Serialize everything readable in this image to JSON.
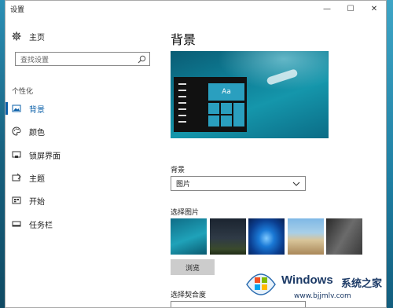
{
  "window": {
    "title": "设置",
    "controls": [
      "—",
      "☐",
      "✕"
    ]
  },
  "nav": {
    "home_label": "主页",
    "search_placeholder": "查找设置",
    "section_title": "个性化",
    "items": [
      {
        "label": "背景",
        "icon": "picture-icon",
        "active": true
      },
      {
        "label": "颜色",
        "icon": "palette-icon",
        "active": false
      },
      {
        "label": "锁屏界面",
        "icon": "lock-screen-icon",
        "active": false
      },
      {
        "label": "主题",
        "icon": "theme-icon",
        "active": false
      },
      {
        "label": "开始",
        "icon": "start-icon",
        "active": false
      },
      {
        "label": "任务栏",
        "icon": "taskbar-icon",
        "active": false
      }
    ]
  },
  "main": {
    "page_title": "背景",
    "preview_tile_text": "Aa",
    "background_label": "背景",
    "background_value": "图片",
    "choose_picture_label": "选择图片",
    "browse_button": "浏览",
    "fit_label": "选择契合度"
  },
  "watermark": {
    "brand": "Windows",
    "brand_cn": "系统之家",
    "url": "www.bjjmlv.com"
  },
  "colors": {
    "accent": "#0a5fa8",
    "tile": "#2a9fbf"
  }
}
